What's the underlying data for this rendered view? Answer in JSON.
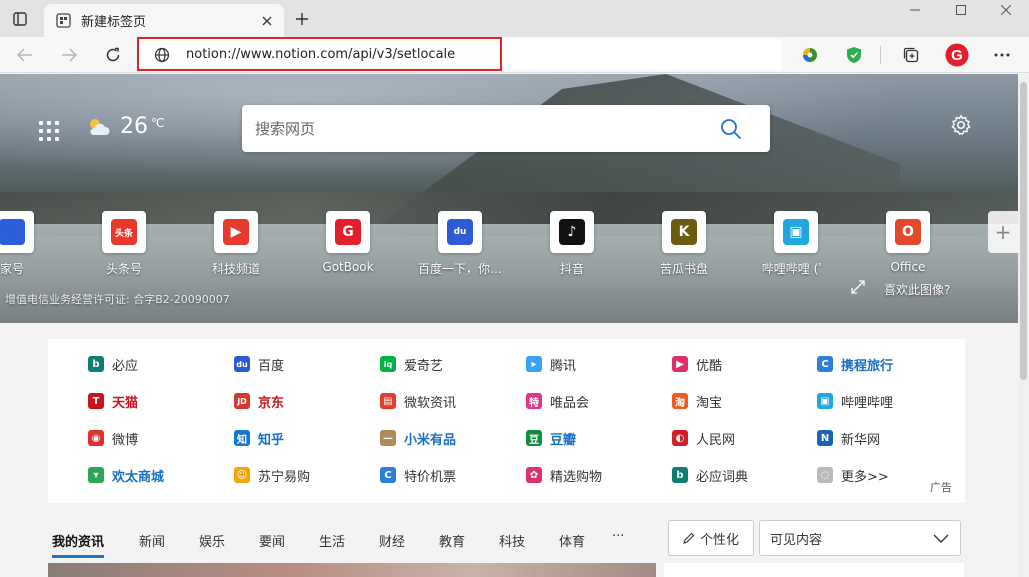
{
  "browser": {
    "tab_title": "新建标签页",
    "url": "notion://www.notion.com/api/v3/setlocale"
  },
  "hero": {
    "temperature": "26",
    "temp_unit": "℃",
    "search_placeholder": "搜索网页",
    "license_text": "增值电信业务经营许可证: 合字B2-20090007",
    "like_image": "喜欢此图像?",
    "tiles": [
      {
        "label": "家号",
        "icon": "paw-icon",
        "color": "#2b5ed8",
        "glyph": "🐾"
      },
      {
        "label": "头条号",
        "icon": "toutiao-icon",
        "color": "#e8372c",
        "glyph": "头条"
      },
      {
        "label": "科技频道",
        "icon": "play-icon",
        "color": "#e63a2e",
        "glyph": "▶"
      },
      {
        "label": "GotBook",
        "icon": "gotbook-icon",
        "color": "#e41e2b",
        "glyph": "G"
      },
      {
        "label": "百度一下，你…",
        "icon": "baidu-icon",
        "color": "#2d5bd4",
        "glyph": "du"
      },
      {
        "label": "抖音",
        "icon": "douyin-icon",
        "color": "#111111",
        "glyph": "♪"
      },
      {
        "label": "苦瓜书盘",
        "icon": "kugua-icon",
        "color": "#6b5a12",
        "glyph": "K"
      },
      {
        "label": "哔哩哔哩 (゜",
        "icon": "bilibili-icon",
        "color": "#22a6e0",
        "glyph": "▣"
      },
      {
        "label": "Office",
        "icon": "office-icon",
        "color": "#e2492b",
        "glyph": "O"
      }
    ]
  },
  "links": [
    {
      "label": "必应",
      "icon": "bing-icon",
      "color": "#0f7d71",
      "glyph": "b",
      "bold": false,
      "text_color": "#333"
    },
    {
      "label": "百度",
      "icon": "baidu-icon",
      "color": "#2d5bd4",
      "glyph": "du",
      "bold": false,
      "text_color": "#333"
    },
    {
      "label": "爱奇艺",
      "icon": "iqiyi-icon",
      "color": "#00b243",
      "glyph": "iq",
      "bold": false,
      "text_color": "#333"
    },
    {
      "label": "腾讯",
      "icon": "tencent-icon",
      "color": "#3da2f5",
      "glyph": "▸",
      "bold": false,
      "text_color": "#333"
    },
    {
      "label": "优酷",
      "icon": "youku-icon",
      "color": "#e0306a",
      "glyph": "▶",
      "bold": false,
      "text_color": "#333"
    },
    {
      "label": "携程旅行",
      "icon": "ctrip-icon",
      "color": "#2f7fd9",
      "glyph": "C",
      "bold": true,
      "text_color": "#1a6fc4"
    },
    {
      "label": "天猫",
      "icon": "tmall-icon",
      "color": "#c8141a",
      "glyph": "T",
      "bold": true,
      "text_color": "#c8141a"
    },
    {
      "label": "京东",
      "icon": "jd-icon",
      "color": "#d8372f",
      "glyph": "JD",
      "bold": true,
      "text_color": "#c8141a"
    },
    {
      "label": "微软资讯",
      "icon": "msn-icon",
      "color": "#e33b2e",
      "glyph": "▤",
      "bold": false,
      "text_color": "#333"
    },
    {
      "label": "唯品会",
      "icon": "vip-icon",
      "color": "#e2338c",
      "glyph": "特",
      "bold": false,
      "text_color": "#333"
    },
    {
      "label": "淘宝",
      "icon": "taobao-icon",
      "color": "#f05a23",
      "glyph": "淘",
      "bold": false,
      "text_color": "#333"
    },
    {
      "label": "哔哩哔哩",
      "icon": "bilibili-icon",
      "color": "#22a6e0",
      "glyph": "▣",
      "bold": false,
      "text_color": "#333"
    },
    {
      "label": "微博",
      "icon": "weibo-icon",
      "color": "#e0302b",
      "glyph": "◉",
      "bold": false,
      "text_color": "#333"
    },
    {
      "label": "知乎",
      "icon": "zhihu-icon",
      "color": "#1677d2",
      "glyph": "知",
      "bold": true,
      "text_color": "#1a6fc4"
    },
    {
      "label": "小米有品",
      "icon": "youpin-icon",
      "color": "#b08a5a",
      "glyph": "—",
      "bold": true,
      "text_color": "#1a6fc4"
    },
    {
      "label": "豆瓣",
      "icon": "douban-icon",
      "color": "#0f8e3c",
      "glyph": "豆",
      "bold": true,
      "text_color": "#1a6fc4"
    },
    {
      "label": "人民网",
      "icon": "people-icon",
      "color": "#d0202a",
      "glyph": "◐",
      "bold": false,
      "text_color": "#333"
    },
    {
      "label": "新华网",
      "icon": "xinhua-icon",
      "color": "#1b63b8",
      "glyph": "N",
      "bold": false,
      "text_color": "#333"
    },
    {
      "label": "欢太商城",
      "icon": "heytap-icon",
      "color": "#2fa55a",
      "glyph": "▾",
      "bold": true,
      "text_color": "#1a6fc4"
    },
    {
      "label": "苏宁易购",
      "icon": "suning-icon",
      "color": "#f2a60c",
      "glyph": "☺",
      "bold": false,
      "text_color": "#333"
    },
    {
      "label": "特价机票",
      "icon": "flight-icon",
      "color": "#2f7fd9",
      "glyph": "C",
      "bold": false,
      "text_color": "#333"
    },
    {
      "label": "精选购物",
      "icon": "shopping-icon",
      "color": "#e0306a",
      "glyph": "✿",
      "bold": false,
      "text_color": "#333"
    },
    {
      "label": "必应词典",
      "icon": "bing-dict-icon",
      "color": "#0f7d71",
      "glyph": "b",
      "bold": false,
      "text_color": "#333"
    },
    {
      "label": "更多>>",
      "icon": "more-icon",
      "color": "#bbbbbb",
      "glyph": "◌",
      "bold": false,
      "text_color": "#333"
    }
  ],
  "ad_label": "广告",
  "news": {
    "tabs": [
      "我的资讯",
      "新闻",
      "娱乐",
      "要闻",
      "生活",
      "财经",
      "教育",
      "科技",
      "体育"
    ],
    "more": "···",
    "personalize": "个性化",
    "visible_content": "可见内容"
  }
}
